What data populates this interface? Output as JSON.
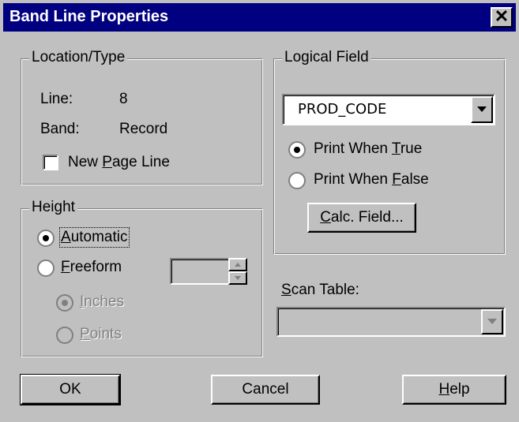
{
  "window": {
    "title": "Band Line Properties",
    "close_glyph": "✕"
  },
  "location_group": {
    "legend": "Location/Type",
    "line_label": "Line:",
    "line_value": "8",
    "band_label": "Band:",
    "band_value": "Record",
    "new_page_line": {
      "pre": "New ",
      "accel": "P",
      "post": "age Line",
      "checked": false
    }
  },
  "height_group": {
    "legend": "Height",
    "automatic": {
      "accel": "A",
      "post": "utomatic",
      "selected": true
    },
    "freeform": {
      "pre": "",
      "accel": "F",
      "post": "reeform",
      "selected": false,
      "value": ""
    },
    "inches": {
      "accel": "I",
      "post": "nches",
      "selected": true,
      "enabled": false
    },
    "points": {
      "accel": "P",
      "post": "oints",
      "selected": false,
      "enabled": false
    }
  },
  "logical_group": {
    "legend": "Logical Field",
    "field_value": "PROD_CODE",
    "print_true": {
      "pre": "Print When ",
      "accel": "T",
      "post": "rue",
      "selected": true
    },
    "print_false": {
      "pre": "Print When ",
      "accel": "F",
      "post": "alse",
      "selected": false
    },
    "calc_button": {
      "accel": "C",
      "post": "alc. Field..."
    }
  },
  "scan_table": {
    "accel": "S",
    "post": "can Table:",
    "value": ""
  },
  "buttons": {
    "ok": "OK",
    "cancel": "Cancel",
    "help_accel": "H",
    "help_post": "elp"
  }
}
